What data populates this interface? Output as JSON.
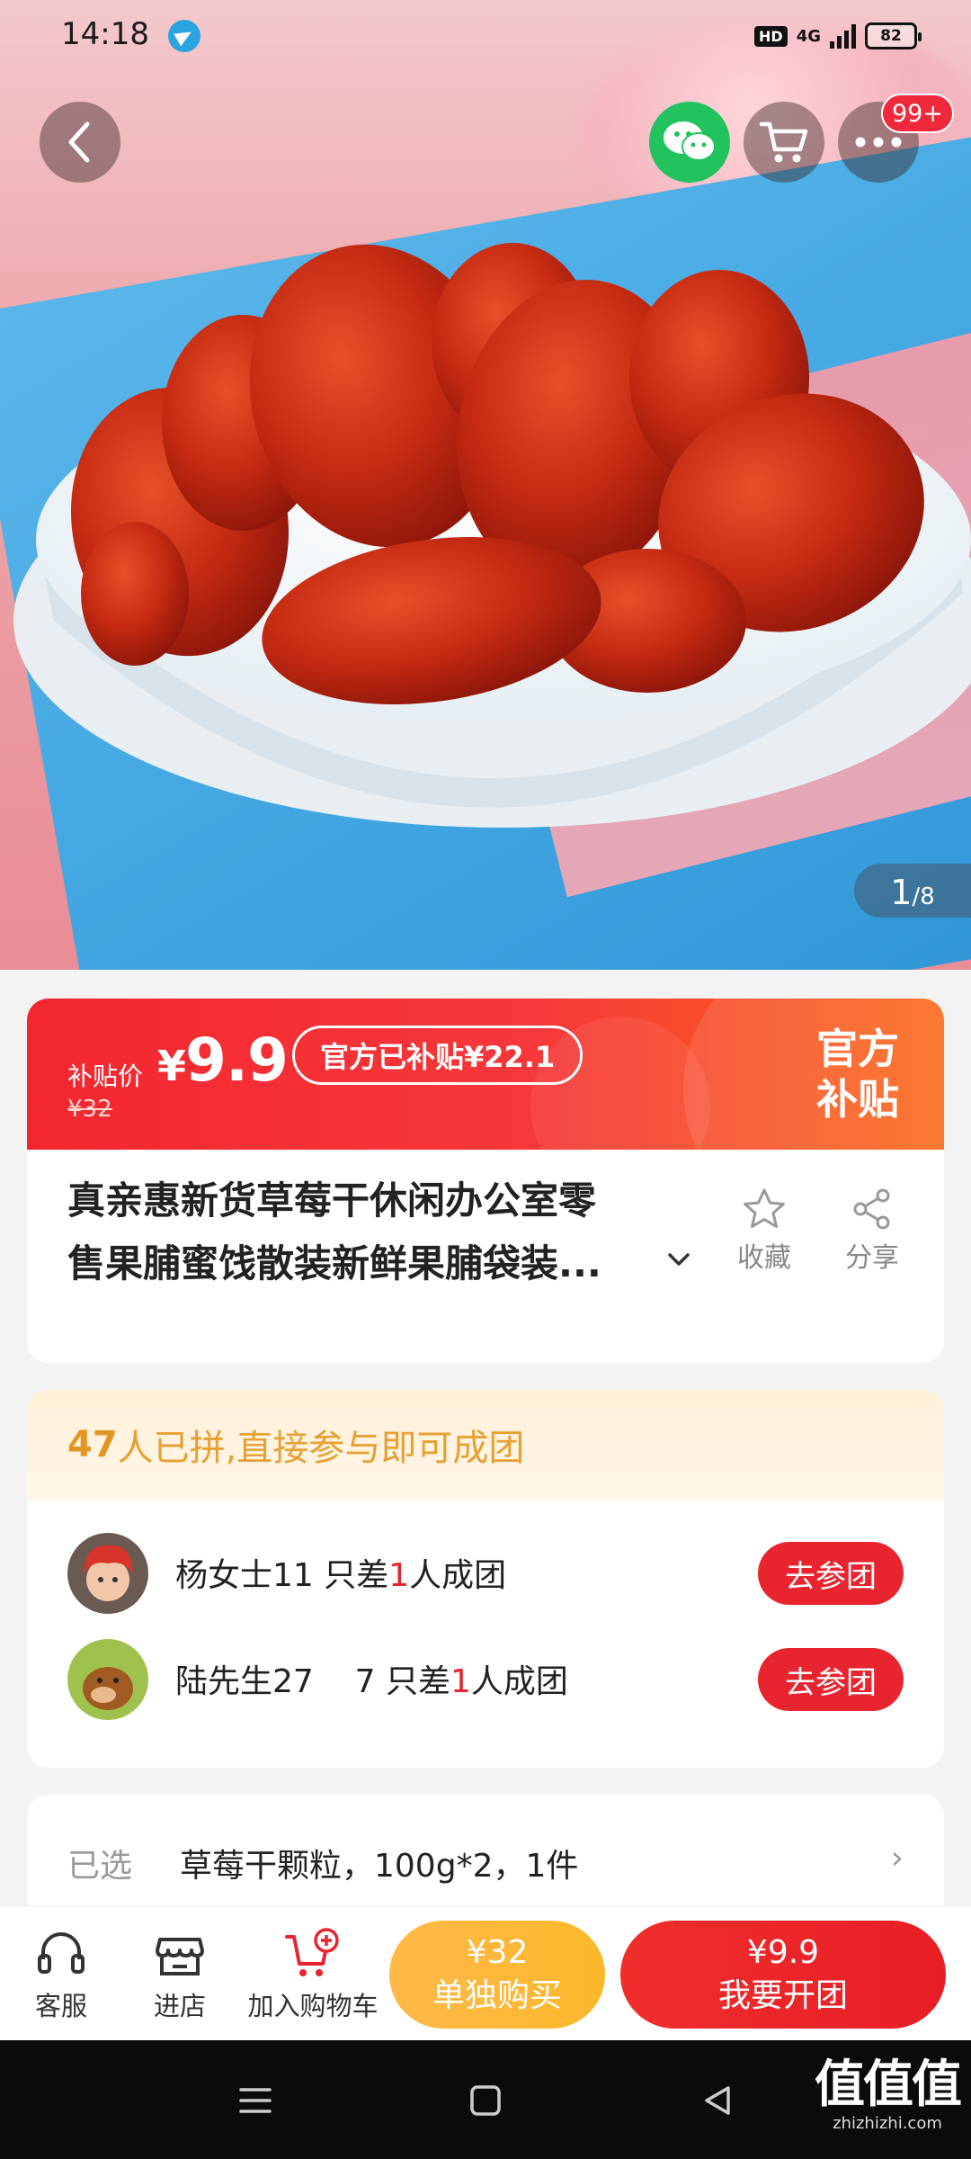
{
  "status_bar": {
    "time": "14:18",
    "network": "4G",
    "battery": "82"
  },
  "header": {
    "cart_badge": "99+"
  },
  "gallery": {
    "current": "1",
    "total": "/8"
  },
  "price": {
    "subsidy_label": "补贴价",
    "currency": "¥",
    "current_price": "9.9",
    "original_price": "¥32",
    "official_subsidy": "官方已补贴¥22.1",
    "official_tag_line1": "官方",
    "official_tag_line2": "补贴"
  },
  "product": {
    "title_line1": "真亲惠新货草莓干休闲办公室零",
    "title_line2": "售果脯蜜饯散装新鲜果脯袋装...",
    "favorite_label": "收藏",
    "share_label": "分享"
  },
  "group_buy": {
    "header_count": "47",
    "header_text": "人已拼,直接参与即可成团",
    "groups": [
      {
        "name": "杨女士11",
        "prefix": " 只差",
        "count": "1",
        "suffix": "人成团",
        "button": "去参团"
      },
      {
        "name": "陆先生27    7",
        "prefix": " 只差",
        "count": "1",
        "suffix": "人成团",
        "button": "去参团"
      }
    ]
  },
  "selection": {
    "label": "已选",
    "value": "草莓干颗粒，100g*2，1件",
    "arrow": "›"
  },
  "action_bar": {
    "service_label": "客服",
    "store_label": "进店",
    "cart_label": "加入购物车",
    "buy_alone_price": "¥32",
    "buy_alone_label": "单独购买",
    "buy_group_price": "¥9.9",
    "buy_group_label": "我要开团"
  },
  "watermark": {
    "logo": "值值值",
    "domain": "zhizhizhi.com"
  },
  "colors": {
    "accent_red": "#e8242e",
    "accent_orange": "#fbb82a",
    "wechat_green": "#22c35e"
  }
}
